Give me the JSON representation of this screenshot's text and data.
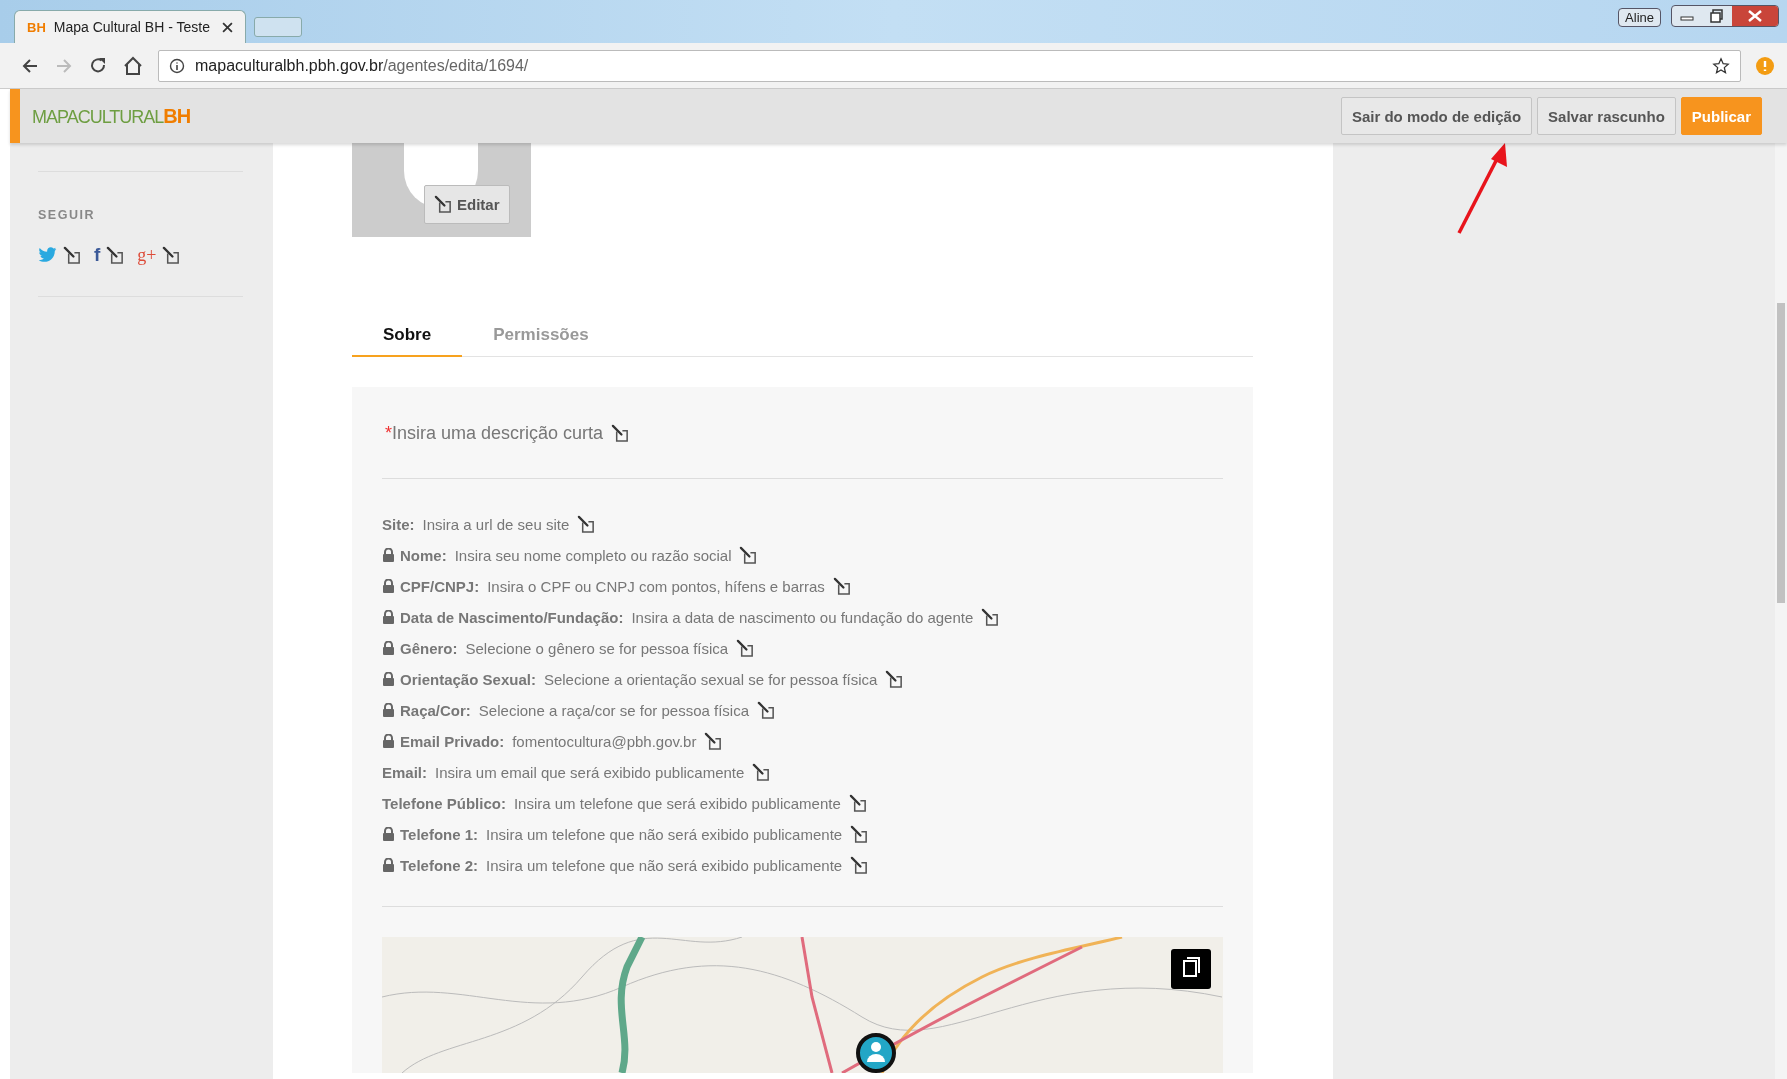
{
  "browser": {
    "tab": {
      "favicon": "BH",
      "title": "Mapa Cultural BH - Teste"
    },
    "profile": "Aline",
    "address": {
      "host": "mapaculturalbh.pbh.gov.br",
      "path": "/agentes/edita/1694/"
    }
  },
  "header": {
    "logo": {
      "text": "MAPACULTURAL",
      "accent": "BH"
    },
    "buttons": [
      {
        "label": "Sair do modo de edição",
        "kind": "secondary"
      },
      {
        "label": "Salvar rascunho",
        "kind": "secondary"
      },
      {
        "label": "Publicar",
        "kind": "primary"
      }
    ]
  },
  "sidebar": {
    "heading": "SEGUIR",
    "social": [
      {
        "kind": "twitter"
      },
      {
        "kind": "facebook",
        "glyph": "f"
      },
      {
        "kind": "googleplus",
        "glyph": "g+"
      }
    ]
  },
  "avatar": {
    "edit_button": "Editar"
  },
  "tabs": [
    {
      "label": "Sobre",
      "selected": true
    },
    {
      "label": "Permissões",
      "selected": false
    }
  ],
  "description": {
    "required_mark": "*",
    "prompt": "Insira uma descrição curta"
  },
  "fields": [
    {
      "label": "Site:",
      "value": "Insira a url de seu site",
      "locked": false
    },
    {
      "label": "Nome:",
      "value": "Insira seu nome completo ou razão social",
      "locked": true
    },
    {
      "label": "CPF/CNPJ:",
      "value": "Insira o CPF ou CNPJ com pontos, hífens e barras",
      "locked": true
    },
    {
      "label": "Data de Nascimento/Fundação:",
      "value": "Insira a data de nascimento ou fundação do agente",
      "locked": true
    },
    {
      "label": "Gênero:",
      "value": "Selecione o gênero se for pessoa física",
      "locked": true
    },
    {
      "label": "Orientação Sexual:",
      "value": "Selecione a orientação sexual se for pessoa física",
      "locked": true
    },
    {
      "label": "Raça/Cor:",
      "value": "Selecione a raça/cor se for pessoa física",
      "locked": true
    },
    {
      "label": "Email Privado:",
      "value": "fomentocultura@pbh.gov.br",
      "locked": true
    },
    {
      "label": "Email:",
      "value": "Insira um email que será exibido publicamente",
      "locked": false
    },
    {
      "label": "Telefone Público:",
      "value": "Insira um telefone que será exibido publicamente",
      "locked": false
    },
    {
      "label": "Telefone 1:",
      "value": "Insira um telefone que não será exibido publicamente",
      "locked": true
    },
    {
      "label": "Telefone 2:",
      "value": "Insira um telefone que não será exibido publicamente",
      "locked": true
    }
  ]
}
